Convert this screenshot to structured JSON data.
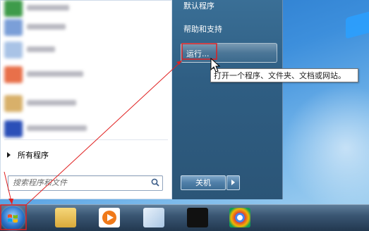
{
  "start_menu": {
    "right_pane": {
      "default_programs": "默认程序",
      "help_support": "帮助和支持",
      "run": "运行..."
    },
    "all_programs": "所有程序",
    "search": {
      "placeholder": "搜索程序和文件"
    },
    "shutdown": "关机"
  },
  "tooltip": "打开一个程序、文件夹、文档或网站。",
  "colors": {
    "annotation": "#e02020",
    "right_pane": "#2f5e83"
  },
  "icons": {
    "taskbar": [
      "start-orb-icon",
      "file-explorer-icon",
      "media-player-icon",
      "notepad-icon",
      "black-window-icon",
      "chrome-icon"
    ]
  }
}
